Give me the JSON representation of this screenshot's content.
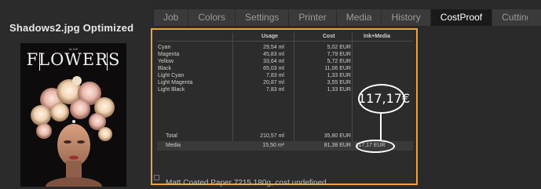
{
  "title": "Shadows2.jpg Optimized",
  "preview": {
    "word": "FLOWERS",
    "small_text": "ALICE"
  },
  "tabs": [
    "Job",
    "Colors",
    "Settings",
    "Printer",
    "Media",
    "History",
    "CostProof",
    "Cutting"
  ],
  "active_tab": "CostProof",
  "table": {
    "headers": {
      "usage": "Usage",
      "cost": "Cost",
      "ink_media": "Ink+Media"
    },
    "rows": [
      {
        "name": "Cyan",
        "usage": "29,54 ml",
        "cost": "5,02 EUR"
      },
      {
        "name": "Magenta",
        "usage": "45,83 ml",
        "cost": "7,79 EUR"
      },
      {
        "name": "Yellow",
        "usage": "33,64 ml",
        "cost": "5,72 EUR"
      },
      {
        "name": "Black",
        "usage": "65,03 ml",
        "cost": "11,06 EUR"
      },
      {
        "name": "Light Cyan",
        "usage": "7,83 ml",
        "cost": "1,33 EUR"
      },
      {
        "name": "Light Magenta",
        "usage": "20,87 ml",
        "cost": "3,55 EUR"
      },
      {
        "name": "Light Black",
        "usage": "7,83 ml",
        "cost": "1,33 EUR"
      }
    ],
    "total": {
      "name": "Total",
      "usage": "210,57 ml",
      "cost": "35,80 EUR"
    },
    "media": {
      "name": "Media",
      "usage": "15,50 m²",
      "cost": "81,38 EUR",
      "ink_media": "117,17 EUR"
    }
  },
  "callout": "117,17€",
  "status": "Matt Coated Paper 7215 180g, cost undefined",
  "colors": {
    "highlight": "#f0a238",
    "active_tab_bg": "#1a1a1a"
  }
}
